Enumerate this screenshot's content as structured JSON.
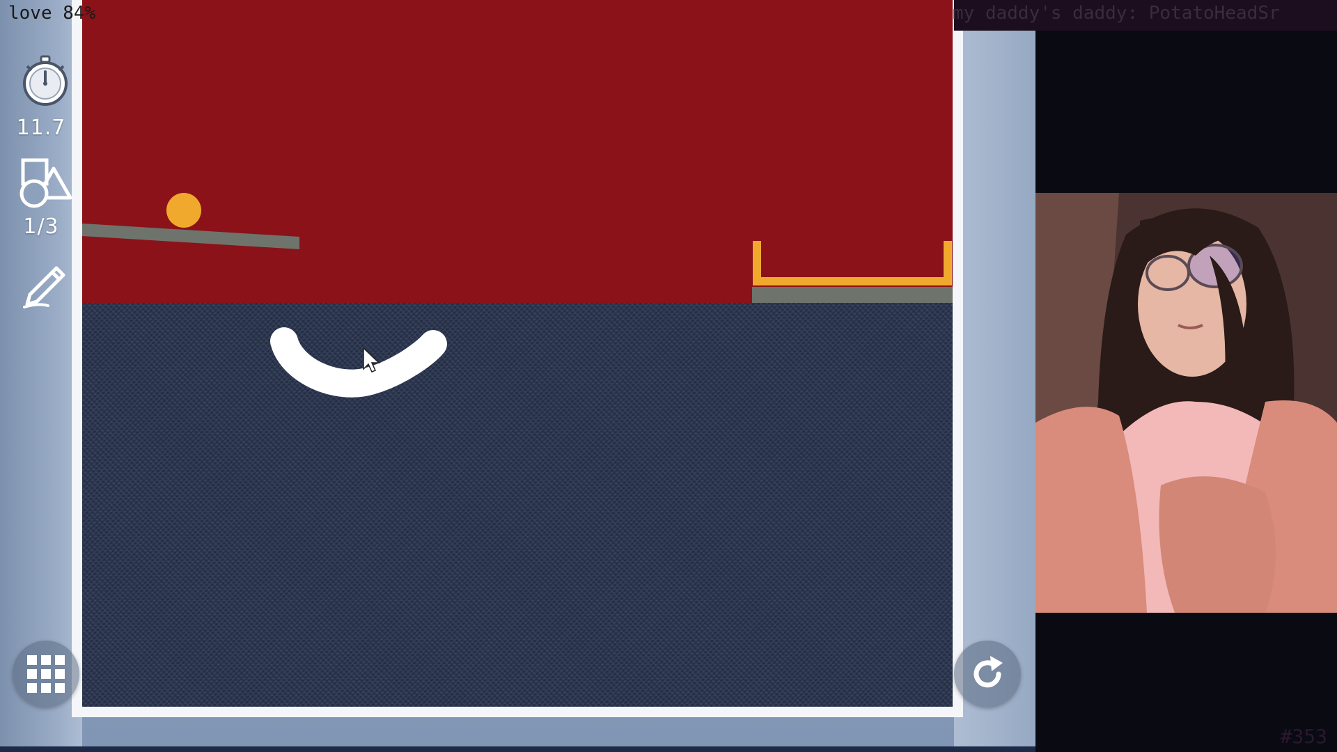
{
  "overlay": {
    "love_text": "love 84%",
    "daddy_text": "my daddy's daddy: PotatoHeadSr",
    "counter": "#353"
  },
  "hud": {
    "timer_value": "11.7",
    "shapes_value": "1/3",
    "icons": {
      "timer": "stopwatch-icon",
      "shapes": "shapes-icon",
      "draw": "pencil-icon",
      "menu": "grid-menu-icon",
      "restart": "restart-icon"
    }
  },
  "colors": {
    "sky": "#8b1219",
    "ground": "#2b3650",
    "ball": "#f0a92d",
    "platform": "#6e746c",
    "goal_cup": "#f0a92d",
    "drawn_shape": "#ffffff"
  }
}
